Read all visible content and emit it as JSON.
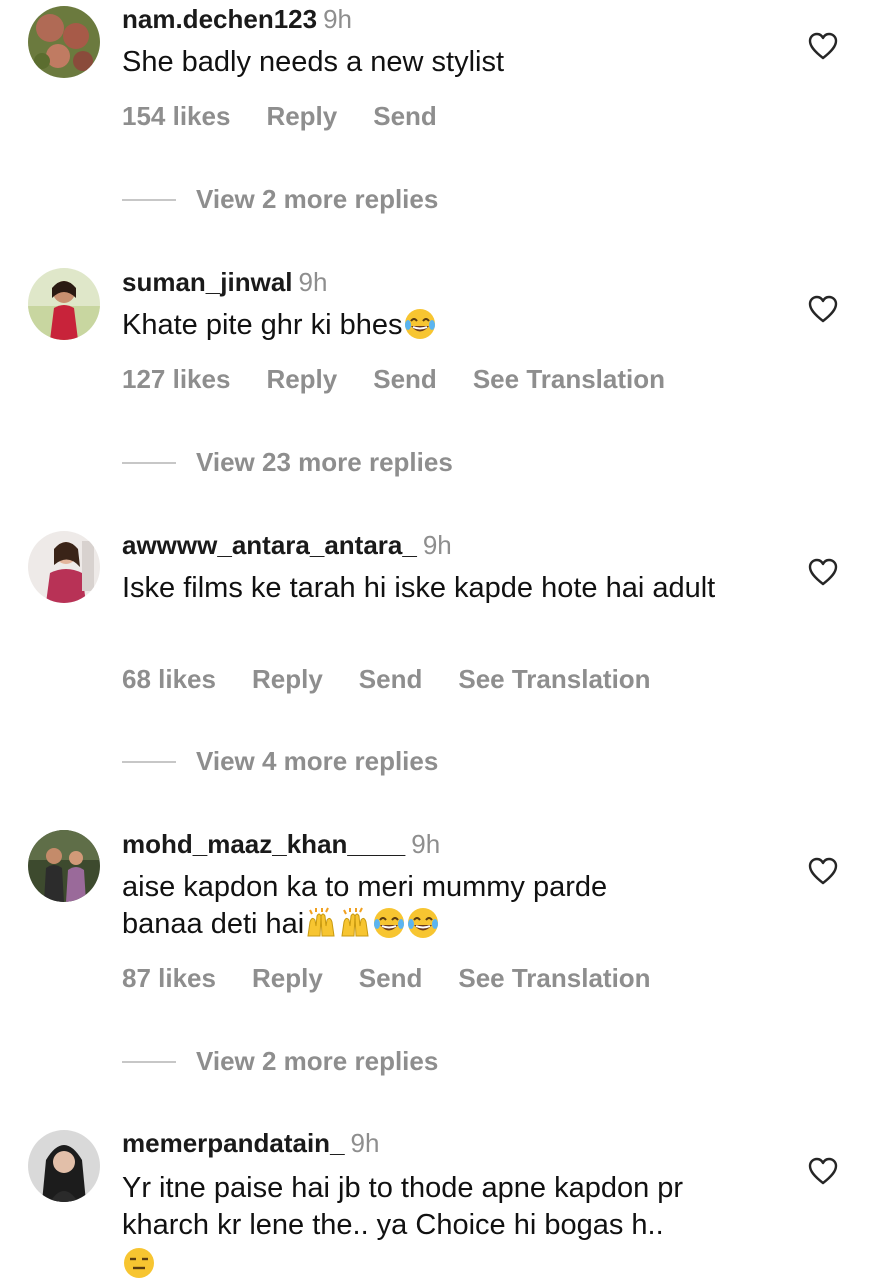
{
  "comments": [
    {
      "username": "nam.dechen123",
      "time": "9h",
      "text": "She badly needs a new stylist",
      "likes": "154 likes",
      "reply": "Reply",
      "send": "Send",
      "view_replies": "View 2 more replies"
    },
    {
      "username": "suman_jinwal",
      "time": "9h",
      "text": "Khate pite ghr ki bhes",
      "likes": "127 likes",
      "reply": "Reply",
      "send": "Send",
      "translate": "See Translation",
      "view_replies": "View 23 more replies"
    },
    {
      "username": "awwww_antara_antara_",
      "time": "9h",
      "text": "Iske films ke tarah hi iske kapde hote hai adult",
      "likes": "68 likes",
      "reply": "Reply",
      "send": "Send",
      "translate": "See Translation",
      "view_replies": "View 4 more replies"
    },
    {
      "username": "mohd_maaz_khan____",
      "time": "9h",
      "text_line1": "aise kapdon ka to meri mummy parde",
      "text_line2": "banaa deti hai",
      "likes": "87 likes",
      "reply": "Reply",
      "send": "Send",
      "translate": "See Translation",
      "view_replies": "View 2 more replies"
    },
    {
      "username": "memerpandatain_",
      "time": "9h",
      "text": "Yr itne paise hai jb to thode apne kapdon pr kharch kr lene the.. ya Choice hi bogas h.."
    }
  ],
  "icons": {
    "like": "heart-outline-icon",
    "laugh": "face-with-tears-of-joy-emoji",
    "raise": "raising-hands-emoji",
    "expressionless": "expressionless-face-emoji"
  },
  "colors": {
    "text": "#111111",
    "muted": "#8e8e8e",
    "divider": "#c7c7c7"
  }
}
